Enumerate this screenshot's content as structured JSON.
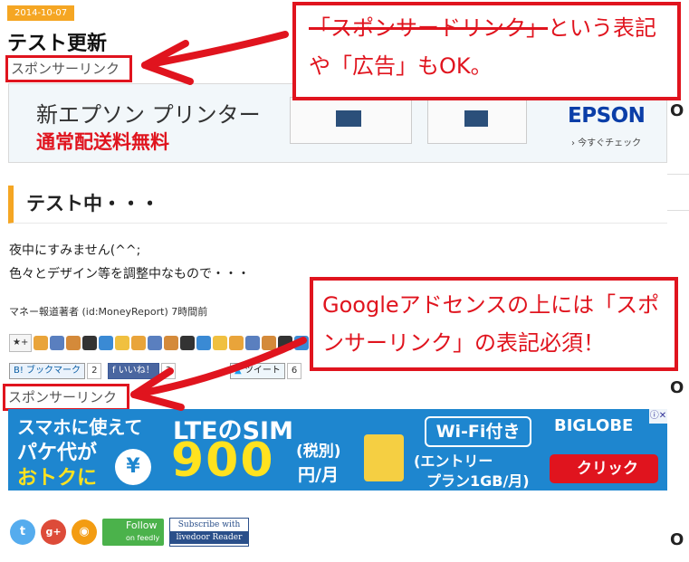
{
  "entry": {
    "date": "2014-10-07",
    "title": "テスト更新",
    "sponsored_label_top": "スポンサーリンク",
    "heading": "テスト中・・・",
    "body_line1": "夜中にすみません(^^;",
    "body_line2": "色々とデザイン等を調整中なもので・・・",
    "author_line": "マネー報道著者 (id:MoneyReport) 7時間前",
    "sponsored_label_bottom": "スポンサーリンク"
  },
  "ad_top": {
    "line1": "新エプソン プリンター",
    "line2": "通常配送料無料",
    "brand": "EPSON",
    "cta": "› 今すぐチェック"
  },
  "star_bar": {
    "add_star_label": "★+",
    "star_count": 18
  },
  "social": {
    "hatena_label": "B! ブックマーク",
    "hatena_count": "2",
    "facebook_label": "f いいね！",
    "facebook_count": "3",
    "twitter_label": "ツイート",
    "twitter_count": "6"
  },
  "ad_bottom": {
    "text1": "スマホに使えて",
    "text2": "パケ代が",
    "text3": "おトクに",
    "lte": "LTEのSIM",
    "price": "900",
    "price_note": "(税別)",
    "unit": "円/月",
    "wifi": "Wi-Fi付き",
    "plan1": "(エントリー",
    "plan2": "プラン1GB/月)",
    "brand": "BIGLOBE",
    "cta": "クリック",
    "badge": "ⓘ✕",
    "yen_symbol": "¥"
  },
  "footer": {
    "feedly_label1": "Follow",
    "feedly_label2": "on feedly",
    "ldr_label1": "Subscribe with",
    "ldr_label2": "livedoor Reader",
    "twitter_icon_glyph": "t",
    "gplus_icon_glyph": "g+",
    "rss_icon_glyph": "◉"
  },
  "callouts": {
    "callout1_strike": "「スポンサードリンク」",
    "callout1_rest": "という表記や「広告」もOK。",
    "callout2": "Googleアドセンスの上には「スポンサーリンク」の表記必須！"
  },
  "sidebar": {
    "glyph": "O"
  },
  "colors": {
    "accent": "#f5a623",
    "annotation_red": "#e0141e",
    "epson_blue": "#0b3ea8",
    "ad_blue": "#1e86cf"
  }
}
